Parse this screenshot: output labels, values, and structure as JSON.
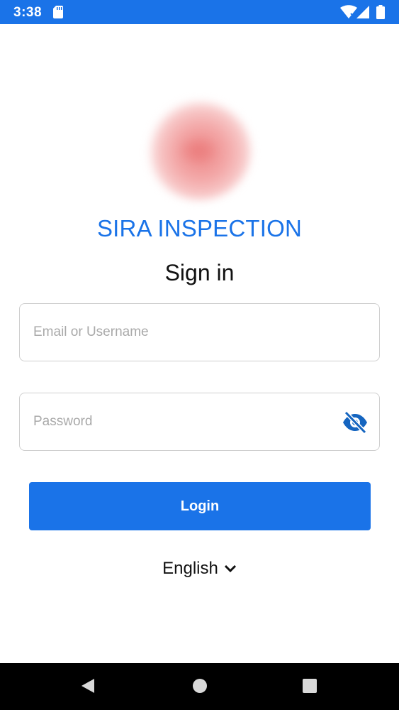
{
  "status_bar": {
    "time": "3:38",
    "icons": [
      "sd-card-icon",
      "wifi-icon",
      "signal-icon",
      "battery-icon"
    ],
    "background": "#1a73e8"
  },
  "app": {
    "logo_icon": "app-logo-icon",
    "title": "SIRA INSPECTION",
    "title_color": "#1a73e8"
  },
  "form": {
    "heading": "Sign in",
    "email_placeholder": "Email or Username",
    "email_value": "",
    "password_placeholder": "Password",
    "password_value": "",
    "password_toggle_icon": "eye-off-icon",
    "login_label": "Login",
    "accent_color": "#1a73e8"
  },
  "language": {
    "selected": "English",
    "icon": "chevron-down-icon"
  },
  "nav_bar": {
    "icons": [
      "back-icon",
      "home-icon",
      "recent-apps-icon"
    ]
  }
}
